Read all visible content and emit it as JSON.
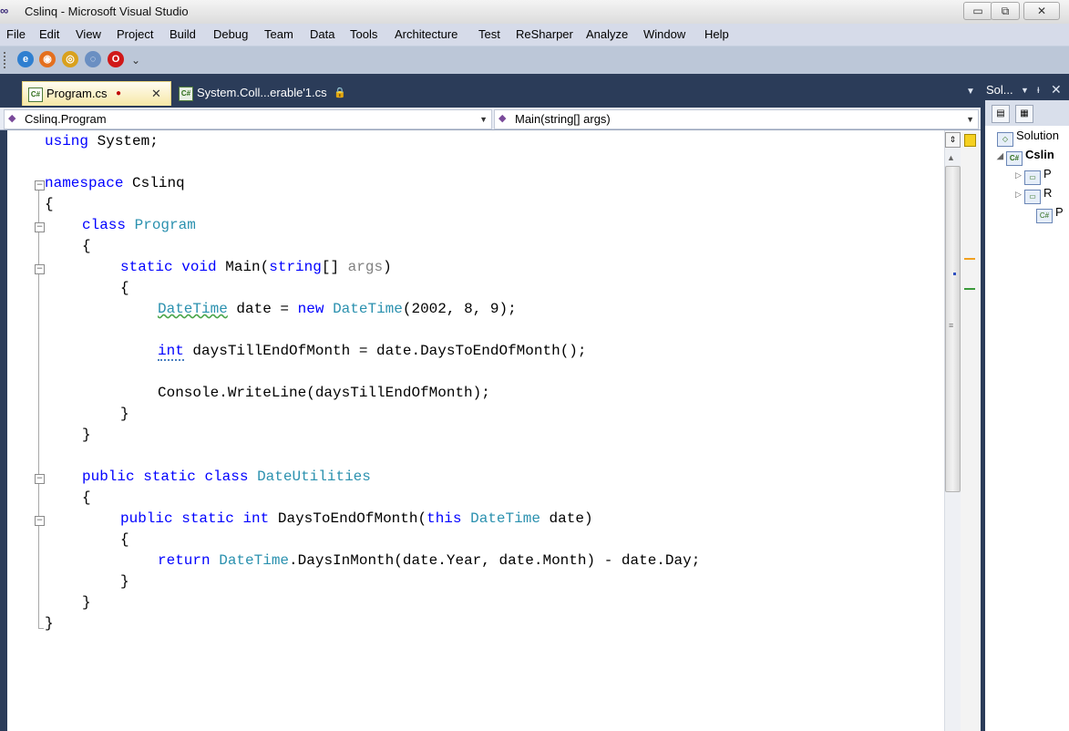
{
  "window": {
    "title": "Cslinq - Microsoft Visual Studio",
    "logo": "vs-infinity-icon",
    "controls": [
      "minimize",
      "restore",
      "close"
    ]
  },
  "menu": [
    "File",
    "Edit",
    "View",
    "Project",
    "Build",
    "Debug",
    "Team",
    "Data",
    "Tools",
    "Architecture",
    "Test",
    "ReSharper",
    "Analyze",
    "Window",
    "Help"
  ],
  "toolbar": {
    "icons": [
      "ie-icon",
      "firefox-icon",
      "chrome-icon",
      "safari-icon",
      "opera-icon"
    ],
    "overflow": "⌄"
  },
  "tabs": [
    {
      "label": "Program.cs",
      "modified": true,
      "active": true
    },
    {
      "label": "System.Coll...erable'1.cs",
      "locked": true,
      "active": false
    }
  ],
  "navbar": {
    "class_combo": "Cslinq.Program",
    "member_combo": "Main(string[] args)"
  },
  "code_lines": [
    "using System;",
    "",
    "namespace Cslinq",
    "{",
    "    class Program",
    "    {",
    "        static void Main(string[] args)",
    "        {",
    "            DateTime date = new DateTime(2002, 8, 9);",
    "",
    "            int daysTillEndOfMonth = date.DaysToEndOfMonth();",
    "",
    "            Console.WriteLine(daysTillEndOfMonth);",
    "        }",
    "    }",
    "",
    "    public static class DateUtilities",
    "    {",
    "        public static int DaysToEndOfMonth(this DateTime date)",
    "        {",
    "            return DateTime.DaysInMonth(date.Year, date.Month) - date.Day;",
    "        }",
    "    }",
    "}"
  ],
  "solution_explorer": {
    "header": "Sol...",
    "tree": [
      {
        "label": "Solution",
        "level": 0
      },
      {
        "label": "Cslin",
        "level": 1,
        "bold": true
      },
      {
        "label": "P",
        "level": 2
      },
      {
        "label": "R",
        "level": 2
      },
      {
        "label": "P",
        "level": 3
      }
    ]
  },
  "colors": {
    "keyword": "#0000ff",
    "type": "#2b91af",
    "parameter": "#808080",
    "chrome_dark": "#2b3c59",
    "active_tab": "#f7e8a6"
  }
}
